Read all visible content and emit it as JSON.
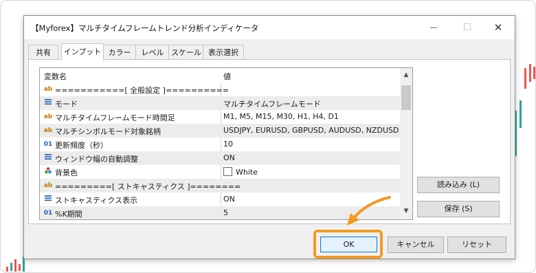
{
  "dialog": {
    "title": "【Myforex】マルチタイムフレームトレンド分析インディケータ",
    "window_controls": {
      "minimize": "—",
      "maximize": "☐",
      "close": "✕"
    }
  },
  "tabs": [
    {
      "label": "共有"
    },
    {
      "label": "インプット"
    },
    {
      "label": "カラー"
    },
    {
      "label": "レベル"
    },
    {
      "label": "スケール"
    },
    {
      "label": "表示選択"
    }
  ],
  "grid": {
    "headers": {
      "name": "変数名",
      "value": "値"
    },
    "rows": [
      {
        "icon": "ab",
        "name": "===========[ 全般設定 ]==========",
        "value": ""
      },
      {
        "icon": "list",
        "name": "モード",
        "value": "マルチタイムフレームモード"
      },
      {
        "icon": "ab",
        "name": "マルチタイムフレームモード時間足",
        "value": "M1, M5, M15, M30, H1, H4, D1"
      },
      {
        "icon": "ab",
        "name": "マルチシンボルモード対象銘柄",
        "value": "USDJPY, EURUSD, GBPUSD, AUDUSD, NZDUSD..."
      },
      {
        "icon": "01",
        "name": "更新頻度（秒）",
        "value": "10"
      },
      {
        "icon": "list",
        "name": "ウィンドウ幅の自動調整",
        "value": "ON"
      },
      {
        "icon": "palette",
        "name": "背景色",
        "value": "White"
      },
      {
        "icon": "ab",
        "name": "=========[ ストキャスティクス ]========",
        "value": ""
      },
      {
        "icon": "list",
        "name": "ストキャスティクス表示",
        "value": "ON"
      },
      {
        "icon": "01",
        "name": "%K期間",
        "value": "5"
      }
    ]
  },
  "buttons": {
    "load": "読み込み (L)",
    "save": "保存 (S)",
    "ok": "OK",
    "cancel": "キャンセル",
    "reset": "リセット"
  },
  "colors": {
    "highlight": "#f29a22",
    "candle_up": "#26a69a",
    "candle_down": "#ef5350"
  }
}
